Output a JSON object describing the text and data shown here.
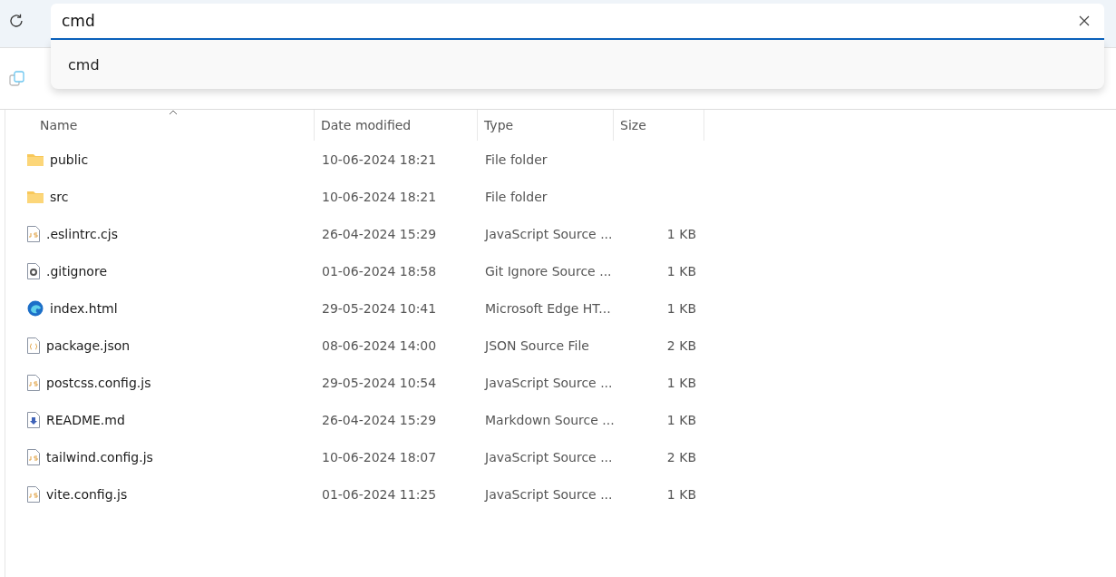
{
  "address_bar": {
    "value": "cmd",
    "suggestions": [
      "cmd"
    ]
  },
  "table": {
    "columns": [
      "Name",
      "Date modified",
      "Type",
      "Size"
    ],
    "rows": [
      {
        "kind": "folder",
        "name": "public",
        "date": "10-06-2024 18:21",
        "type": "File folder"
      },
      {
        "kind": "folder",
        "name": "src",
        "date": "10-06-2024 18:21",
        "type": "File folder"
      },
      {
        "kind": "js",
        "name": ".eslintrc.cjs",
        "date": "26-04-2024 15:29",
        "type": "JavaScript Source ...",
        "size": "1 KB"
      },
      {
        "kind": "settings",
        "name": ".gitignore",
        "date": "01-06-2024 18:58",
        "type": "Git Ignore Source ...",
        "size": "1 KB"
      },
      {
        "kind": "browser",
        "name": "index.html",
        "date": "29-05-2024 10:41",
        "type": "Microsoft Edge HT...",
        "size": "1 KB"
      },
      {
        "kind": "json",
        "name": "package.json",
        "date": "08-06-2024 14:00",
        "type": "JSON Source File",
        "size": "2 KB"
      },
      {
        "kind": "js",
        "name": "postcss.config.js",
        "date": "29-05-2024 10:54",
        "type": "JavaScript Source ...",
        "size": "1 KB"
      },
      {
        "kind": "markdown",
        "name": "README.md",
        "date": "26-04-2024 15:29",
        "type": "Markdown Source ...",
        "size": "1 KB"
      },
      {
        "kind": "js",
        "name": "tailwind.config.js",
        "date": "10-06-2024 18:07",
        "type": "JavaScript Source ...",
        "size": "2 KB"
      },
      {
        "kind": "js",
        "name": "vite.config.js",
        "date": "01-06-2024 11:25",
        "type": "JavaScript Source ...",
        "size": "1 KB"
      }
    ]
  }
}
